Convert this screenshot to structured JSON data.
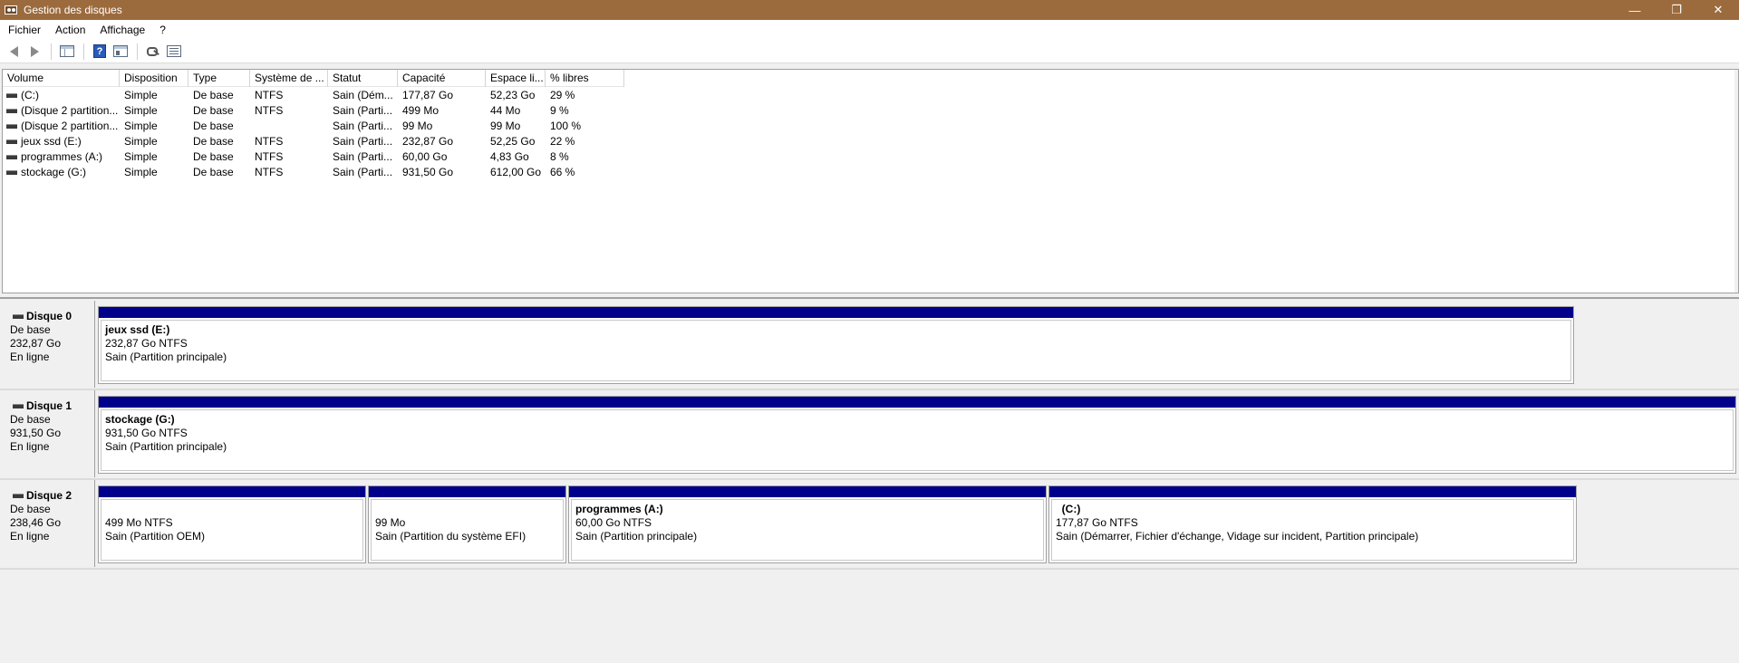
{
  "window": {
    "title": "Gestion des disques",
    "controls": [
      "—",
      "❐",
      "✕"
    ]
  },
  "menu": [
    "Fichier",
    "Action",
    "Affichage",
    "?"
  ],
  "toolbar": {
    "buttons": [
      "back-icon",
      "forward-icon",
      "console-tree-icon",
      "help-icon",
      "show-hide-icon",
      "key-icon",
      "list-icon"
    ]
  },
  "volume_list": {
    "columns": [
      "Volume",
      "Disposition",
      "Type",
      "Système de ...",
      "Statut",
      "Capacité",
      "Espace li...",
      "% libres"
    ],
    "rows": [
      [
        "(C:)",
        "Simple",
        "De base",
        "NTFS",
        "Sain (Dém...",
        "177,87 Go",
        "52,23 Go",
        "29 %"
      ],
      [
        "(Disque 2 partition...",
        "Simple",
        "De base",
        "NTFS",
        "Sain (Parti...",
        "499 Mo",
        "44 Mo",
        "9 %"
      ],
      [
        "(Disque 2 partition...",
        "Simple",
        "De base",
        "",
        "Sain (Parti...",
        "99 Mo",
        "99 Mo",
        "100 %"
      ],
      [
        "jeux ssd (E:)",
        "Simple",
        "De base",
        "NTFS",
        "Sain (Parti...",
        "232,87 Go",
        "52,25 Go",
        "22 %"
      ],
      [
        "programmes (A:)",
        "Simple",
        "De base",
        "NTFS",
        "Sain (Parti...",
        "60,00 Go",
        "4,83 Go",
        "8 %"
      ],
      [
        "stockage (G:)",
        "Simple",
        "De base",
        "NTFS",
        "Sain (Parti...",
        "931,50 Go",
        "612,00 Go",
        "66 %"
      ]
    ]
  },
  "disks": [
    {
      "name": "Disque 0",
      "type": "De base",
      "size": "232,87 Go",
      "status": "En ligne",
      "partitions": [
        {
          "label": "jeux ssd  (E:)",
          "line1": "232,87 Go NTFS",
          "line2": "Sain (Partition principale)"
        }
      ]
    },
    {
      "name": "Disque 1",
      "type": "De base",
      "size": "931,50 Go",
      "status": "En ligne",
      "partitions": [
        {
          "label": "stockage  (G:)",
          "line1": "931,50 Go NTFS",
          "line2": "Sain (Partition principale)"
        }
      ]
    },
    {
      "name": "Disque 2",
      "type": "De base",
      "size": "238,46 Go",
      "status": "En ligne",
      "partitions": [
        {
          "label": "",
          "line1": "499 Mo NTFS",
          "line2": "Sain (Partition OEM)"
        },
        {
          "label": "",
          "line1": "99 Mo",
          "line2": "Sain (Partition du système EFI)"
        },
        {
          "label": "programmes  (A:)",
          "line1": "60,00 Go NTFS",
          "line2": "Sain (Partition principale)"
        },
        {
          "label": "  (C:)",
          "line1": "177,87 Go NTFS",
          "line2": "Sain (Démarrer, Fichier d'échange, Vidage sur incident, Partition principale)"
        }
      ]
    }
  ],
  "colors": {
    "titlebar": "#9c6b3d",
    "partition_bar": "#00008b"
  }
}
